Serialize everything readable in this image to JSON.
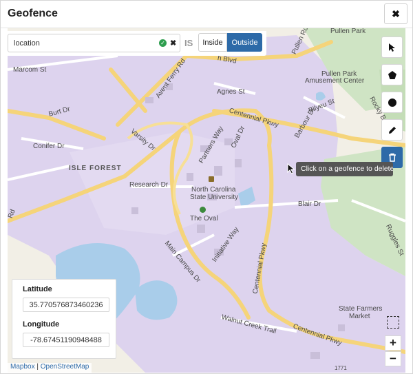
{
  "dialog": {
    "title": "Geofence",
    "close_icon": "close-icon"
  },
  "filter": {
    "search_value": "location",
    "search_placeholder": "",
    "valid_icon": "check-circle-icon",
    "clear_icon": "clear-icon",
    "is_label": "IS",
    "inside_label": "Inside",
    "outside_label": "Outside",
    "selected": "Outside"
  },
  "toolbar": {
    "tools": [
      {
        "name": "select-tool",
        "icon": "pointer-icon"
      },
      {
        "name": "polygon-tool",
        "icon": "pentagon-icon"
      },
      {
        "name": "circle-tool",
        "icon": "circle-icon"
      },
      {
        "name": "edit-tool",
        "icon": "pencil-icon"
      },
      {
        "name": "delete-tool",
        "icon": "trash-icon",
        "active": true
      }
    ],
    "tooltip": "Click on a geofence to delete"
  },
  "map_labels": {
    "pullen_park": "Pullen Park",
    "pullen_park_amusement": "Pullen Park",
    "amusement_center": "Amusement Center",
    "marcom_st": "Marcom St",
    "agnes_st": "Agnes St",
    "bilyeu_st": "Bilyeu St",
    "rocky_br": "Rocky Br",
    "burt_dr": "Burt Dr",
    "conifer_dr": "Conifer Dr",
    "isle_forest": "ISLE FOREST",
    "research_dr": "Research Dr",
    "barbour_dr": "Barbour Dr",
    "varsity_dr": "Varsity Dr",
    "avent_ferry_rd": "Avent Ferry Rd",
    "centennial_pkwy_1": "Centennial Pkwy",
    "centennial_pkwy_2": "Centennial Pkwy",
    "centennial_pkwy_3": "Centennial Pkwy",
    "partners_way": "Partners Way",
    "oval_dr": "Oval Dr",
    "ncsu_line1": "North Carolina",
    "ncsu_line2": "State University",
    "the_oval": "The Oval",
    "blair_dr": "Blair Dr",
    "initiative_way": "Initiative Way",
    "main_campus_dr": "Main Campus Dr",
    "walnut_creek_trail": "Walnut Creek Trail",
    "state_farmers_line1": "State Farmers",
    "state_farmers_line2": "Market",
    "ruggles_st": "Ruggles St",
    "pullen_rd": "Pullen Rd",
    "hillsborough_blvd": "h Blvd",
    "ferry_rd_left": "Rd",
    "route_number": "1771"
  },
  "coordinates": {
    "latitude_label": "Latitude",
    "latitude_value": "35.770576873460236",
    "longitude_label": "Longitude",
    "longitude_value": "-78.67451190948488"
  },
  "map_controls": {
    "box_select_icon": "box-select-icon",
    "zoom_in": "+",
    "zoom_out": "−"
  },
  "attribution": {
    "mapbox": "Mapbox",
    "separator": "|",
    "osm": "OpenStreetMap"
  },
  "colors": {
    "accent": "#2d6aa8",
    "campus_fill": "#ddd3ee",
    "park_green": "#cfe4c4",
    "water": "#a9cdea",
    "road_yellow": "#f5d47a"
  }
}
